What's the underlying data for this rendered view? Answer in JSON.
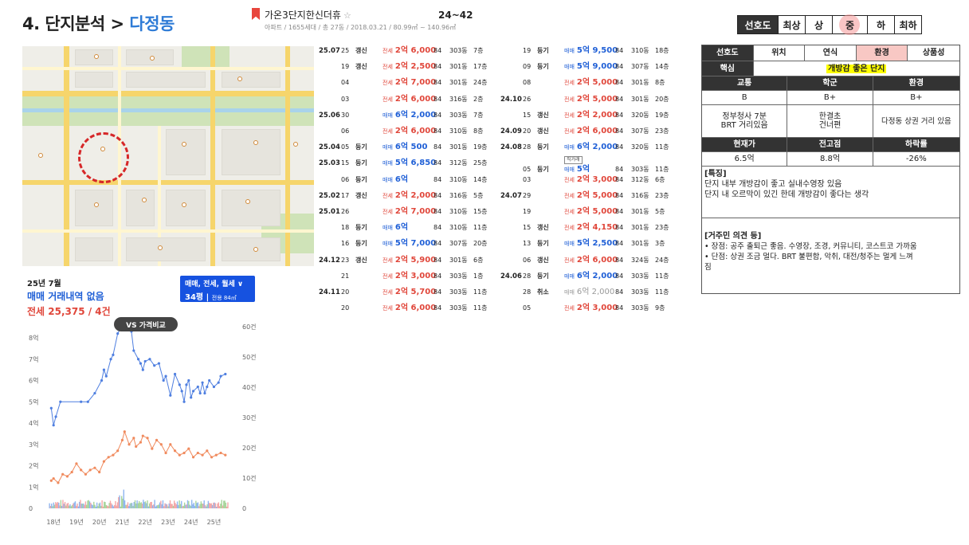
{
  "header": {
    "title_prefix": "4. 단지분석 > ",
    "title_highlight": "다정동",
    "apt_name": "가온3단지한신더휴",
    "star": "☆",
    "apt_sub": "아파트 / 1655세대 / 총 27동 / 2018.03.21 / 80.99㎡ ~ 140.96㎡",
    "range": "24~42"
  },
  "pref_scale": {
    "label": "선호도",
    "levels": [
      "최상",
      "상",
      "중",
      "하",
      "최하"
    ],
    "selected": "중"
  },
  "summary": {
    "month": "25년 7월",
    "sale": "매매 거래내역 없음",
    "rent": "전세 25,375 / 4건",
    "filter_line1": "매매, 전세, 월세 ∨",
    "filter_line2": "34평",
    "filter_line2_small": "전용 84㎡",
    "vs_button": "VS 가격비교"
  },
  "chart_data": {
    "type": "line",
    "x_ticks": [
      "18년",
      "19년",
      "20년",
      "21년",
      "22년",
      "23년",
      "24년",
      "25년"
    ],
    "y_left_ticks": [
      "0",
      "1억",
      "2억",
      "3억",
      "4억",
      "5억",
      "6억",
      "7억",
      "8억"
    ],
    "y_right_ticks": [
      "0",
      "10건",
      "20건",
      "30건",
      "40건",
      "50건",
      "60건"
    ],
    "ylim_left": [
      0,
      8
    ],
    "ylim_right": [
      0,
      60
    ],
    "series": [
      {
        "color": "#4f7fe0",
        "x": [
          2017.9,
          2018.0,
          2018.1,
          2018.3,
          2019.2,
          2019.5,
          2019.8,
          2020.1,
          2020.2,
          2020.3,
          2020.5,
          2020.6,
          2020.8,
          2021.0,
          2021.2,
          2021.4,
          2021.5,
          2021.7,
          2021.8,
          2021.9,
          2022.0,
          2022.2,
          2022.4,
          2022.6,
          2022.8,
          2022.9,
          2023.1,
          2023.3,
          2023.5,
          2023.6,
          2023.7,
          2023.8,
          2023.9,
          2024.0,
          2024.1,
          2024.3,
          2024.4,
          2024.5,
          2024.6,
          2024.7,
          2024.8,
          2025.0,
          2025.2,
          2025.3,
          2025.5
        ],
        "y": [
          4.7,
          3.9,
          4.3,
          5.0,
          5.0,
          5.0,
          5.4,
          6.0,
          6.5,
          6.2,
          7.0,
          7.2,
          8.2,
          8.6,
          8.5,
          8.3,
          7.4,
          7.0,
          6.8,
          6.5,
          6.9,
          7.0,
          6.7,
          6.8,
          6.0,
          6.2,
          5.3,
          6.3,
          5.8,
          5.5,
          5.0,
          5.8,
          6.0,
          5.2,
          5.5,
          5.7,
          5.4,
          5.9,
          5.4,
          5.7,
          6.0,
          5.7,
          5.9,
          6.2,
          6.3
        ]
      },
      {
        "color": "#f08a5d",
        "x": [
          2017.9,
          2018.0,
          2018.2,
          2018.4,
          2018.6,
          2018.8,
          2019.0,
          2019.2,
          2019.4,
          2019.6,
          2019.8,
          2020.0,
          2020.2,
          2020.4,
          2020.6,
          2020.8,
          2021.0,
          2021.1,
          2021.3,
          2021.5,
          2021.6,
          2021.8,
          2021.9,
          2022.1,
          2022.3,
          2022.5,
          2022.7,
          2022.9,
          2023.1,
          2023.3,
          2023.5,
          2023.7,
          2023.9,
          2024.1,
          2024.3,
          2024.5,
          2024.7,
          2024.9,
          2025.1,
          2025.3,
          2025.5
        ],
        "y": [
          1.3,
          1.4,
          1.2,
          1.6,
          1.5,
          1.7,
          2.1,
          1.8,
          1.6,
          1.8,
          1.9,
          1.7,
          2.2,
          2.4,
          2.5,
          2.7,
          3.2,
          3.6,
          3.0,
          3.3,
          2.9,
          3.1,
          3.4,
          3.3,
          2.8,
          3.2,
          3.0,
          2.6,
          3.0,
          2.7,
          2.5,
          2.6,
          2.8,
          2.4,
          2.6,
          2.5,
          2.7,
          2.4,
          2.5,
          2.6,
          2.5
        ]
      }
    ]
  },
  "col1": [
    {
      "mo": "25.07",
      "d": "25",
      "st": "갱신",
      "type": "전세",
      "amt": "2억 6,000",
      "sz": "84",
      "dong": "303동",
      "fl": "7층",
      "color": "red"
    },
    {
      "mo": "",
      "d": "19",
      "st": "갱신",
      "type": "전세",
      "amt": "2억 2,500",
      "sz": "84",
      "dong": "301동",
      "fl": "17층",
      "color": "red"
    },
    {
      "mo": "",
      "d": "04",
      "st": "",
      "type": "전세",
      "amt": "2억 7,000",
      "sz": "84",
      "dong": "301동",
      "fl": "24층",
      "color": "red"
    },
    {
      "mo": "",
      "d": "03",
      "st": "",
      "type": "전세",
      "amt": "2억 6,000",
      "sz": "84",
      "dong": "316동",
      "fl": "2층",
      "color": "red"
    },
    {
      "mo": "25.06",
      "d": "30",
      "st": "",
      "type": "매매",
      "amt": "6억 2,000",
      "sz": "84",
      "dong": "303동",
      "fl": "7층",
      "color": "blue"
    },
    {
      "mo": "",
      "d": "06",
      "st": "",
      "type": "전세",
      "amt": "2억 6,000",
      "sz": "84",
      "dong": "310동",
      "fl": "8층",
      "color": "red"
    },
    {
      "mo": "25.04",
      "d": "05",
      "st": "등기",
      "type": "매매",
      "amt": "6억 500",
      "sz": "84",
      "dong": "301동",
      "fl": "19층",
      "color": "blue"
    },
    {
      "mo": "25.03",
      "d": "15",
      "st": "등기",
      "type": "매매",
      "amt": "5억 6,850",
      "sz": "84",
      "dong": "312동",
      "fl": "25층",
      "color": "blue"
    },
    {
      "mo": "",
      "d": "06",
      "st": "등기",
      "type": "매매",
      "amt": "6억",
      "sz": "84",
      "dong": "310동",
      "fl": "14층",
      "color": "blue"
    },
    {
      "mo": "25.02",
      "d": "17",
      "st": "갱신",
      "type": "전세",
      "amt": "2억 2,000",
      "sz": "84",
      "dong": "316동",
      "fl": "5층",
      "color": "red"
    },
    {
      "mo": "25.01",
      "d": "26",
      "st": "",
      "type": "전세",
      "amt": "2억 7,000",
      "sz": "84",
      "dong": "310동",
      "fl": "15층",
      "color": "red"
    },
    {
      "mo": "",
      "d": "18",
      "st": "등기",
      "type": "매매",
      "amt": "6억",
      "sz": "84",
      "dong": "310동",
      "fl": "11층",
      "color": "blue"
    },
    {
      "mo": "",
      "d": "16",
      "st": "등기",
      "type": "매매",
      "amt": "5억 7,000",
      "sz": "84",
      "dong": "307동",
      "fl": "20층",
      "color": "blue"
    },
    {
      "mo": "24.12",
      "d": "23",
      "st": "갱신",
      "type": "전세",
      "amt": "2억 5,900",
      "sz": "84",
      "dong": "301동",
      "fl": "6층",
      "color": "red"
    },
    {
      "mo": "",
      "d": "21",
      "st": "",
      "type": "전세",
      "amt": "2억 3,000",
      "sz": "84",
      "dong": "303동",
      "fl": "1층",
      "color": "red"
    },
    {
      "mo": "24.11",
      "d": "20",
      "st": "",
      "type": "전세",
      "amt": "2억 5,700",
      "sz": "84",
      "dong": "303동",
      "fl": "11층",
      "color": "red"
    },
    {
      "mo": "",
      "d": "20",
      "st": "",
      "type": "전세",
      "amt": "2억 6,000",
      "sz": "84",
      "dong": "303동",
      "fl": "11층",
      "color": "red"
    }
  ],
  "col2": [
    {
      "mo": "",
      "d": "19",
      "st": "등기",
      "type": "매매",
      "amt": "5억 9,500",
      "sz": "84",
      "dong": "310동",
      "fl": "18층",
      "color": "blue"
    },
    {
      "mo": "",
      "d": "09",
      "st": "등기",
      "type": "매매",
      "amt": "5억 9,000",
      "sz": "84",
      "dong": "307동",
      "fl": "14층",
      "color": "blue"
    },
    {
      "mo": "",
      "d": "08",
      "st": "",
      "type": "전세",
      "amt": "2억 5,000",
      "sz": "84",
      "dong": "301동",
      "fl": "8층",
      "color": "red"
    },
    {
      "mo": "24.10",
      "d": "26",
      "st": "",
      "type": "전세",
      "amt": "2억 5,000",
      "sz": "84",
      "dong": "301동",
      "fl": "20층",
      "color": "red"
    },
    {
      "mo": "",
      "d": "15",
      "st": "갱신",
      "type": "전세",
      "amt": "2억 2,000",
      "sz": "84",
      "dong": "320동",
      "fl": "19층",
      "color": "red"
    },
    {
      "mo": "24.09",
      "d": "20",
      "st": "갱신",
      "type": "전세",
      "amt": "2억 6,000",
      "sz": "84",
      "dong": "307동",
      "fl": "23층",
      "color": "red"
    },
    {
      "mo": "24.08",
      "d": "28",
      "st": "등기",
      "type": "매매",
      "amt": "6억 2,000",
      "sz": "84",
      "dong": "320동",
      "fl": "11층",
      "color": "blue"
    },
    {
      "mo": "",
      "d": "05",
      "st": "등기",
      "type": "매매",
      "amt": "5억",
      "sz": "84",
      "dong": "303동",
      "fl": "11층",
      "color": "blue",
      "tag": "직거래"
    },
    {
      "mo": "",
      "d": "03",
      "st": "",
      "type": "전세",
      "amt": "2억 3,000",
      "sz": "84",
      "dong": "312동",
      "fl": "6층",
      "color": "red"
    },
    {
      "mo": "24.07",
      "d": "29",
      "st": "",
      "type": "전세",
      "amt": "2억 5,000",
      "sz": "84",
      "dong": "316동",
      "fl": "23층",
      "color": "red"
    },
    {
      "mo": "",
      "d": "19",
      "st": "",
      "type": "전세",
      "amt": "2억 5,000",
      "sz": "84",
      "dong": "301동",
      "fl": "5층",
      "color": "red"
    },
    {
      "mo": "",
      "d": "15",
      "st": "갱신",
      "type": "전세",
      "amt": "2억 4,150",
      "sz": "84",
      "dong": "301동",
      "fl": "23층",
      "color": "red"
    },
    {
      "mo": "",
      "d": "13",
      "st": "등기",
      "type": "매매",
      "amt": "5억 2,500",
      "sz": "84",
      "dong": "301동",
      "fl": "3층",
      "color": "blue"
    },
    {
      "mo": "",
      "d": "06",
      "st": "갱신",
      "type": "전세",
      "amt": "2억 6,000",
      "sz": "84",
      "dong": "324동",
      "fl": "24층",
      "color": "red"
    },
    {
      "mo": "24.06",
      "d": "28",
      "st": "등기",
      "type": "매매",
      "amt": "6억 2,000",
      "sz": "84",
      "dong": "303동",
      "fl": "11층",
      "color": "blue"
    },
    {
      "mo": "",
      "d": "28",
      "st": "취소",
      "type": "매매",
      "amt": "6억 2,000",
      "sz": "84",
      "dong": "303동",
      "fl": "11층",
      "color": "grey"
    },
    {
      "mo": "",
      "d": "05",
      "st": "",
      "type": "전세",
      "amt": "2억 3,000",
      "sz": "84",
      "dong": "303동",
      "fl": "9층",
      "color": "red"
    }
  ],
  "info": {
    "tabs": [
      "선호도",
      "위치",
      "연식",
      "환경",
      "상품성"
    ],
    "core_label": "핵심",
    "core_value": "개방감 좋은 단지",
    "h1": [
      "교통",
      "학군",
      "환경"
    ],
    "v1": [
      "B",
      "B+",
      "B+"
    ],
    "d1": [
      "정부청사 7분\nBRT 거리있음",
      "한결초\n건너편",
      "다정동 상권 거리 있음"
    ],
    "h2": [
      "현재가",
      "전고점",
      "하락률"
    ],
    "v2": [
      "6.5억",
      "8.8억",
      "-26%"
    ],
    "feat_title": "[특징]",
    "feat_1": "단지 내부 개방감이 좋고 실내수영장 있음",
    "feat_2": "단지 내 오르막이 있긴 한데 개방감이 좋다는 생각",
    "resid_title": "[거주민 의견 등]",
    "resid_1": "• 장점: 공주 출퇴근 좋음. 수영장, 조경, 커뮤니티, 코스트코 가까움",
    "resid_2": "• 단점: 상권 조금 멀다. BRT 불편함, 악취, 대전/청주는 멀게 느껴",
    "resid_3": "짐"
  },
  "colors": {
    "accent": "#2e7bd6",
    "sale": "#1f5fd6",
    "rent": "#e0463a",
    "highlight": "#f8c8c4"
  }
}
